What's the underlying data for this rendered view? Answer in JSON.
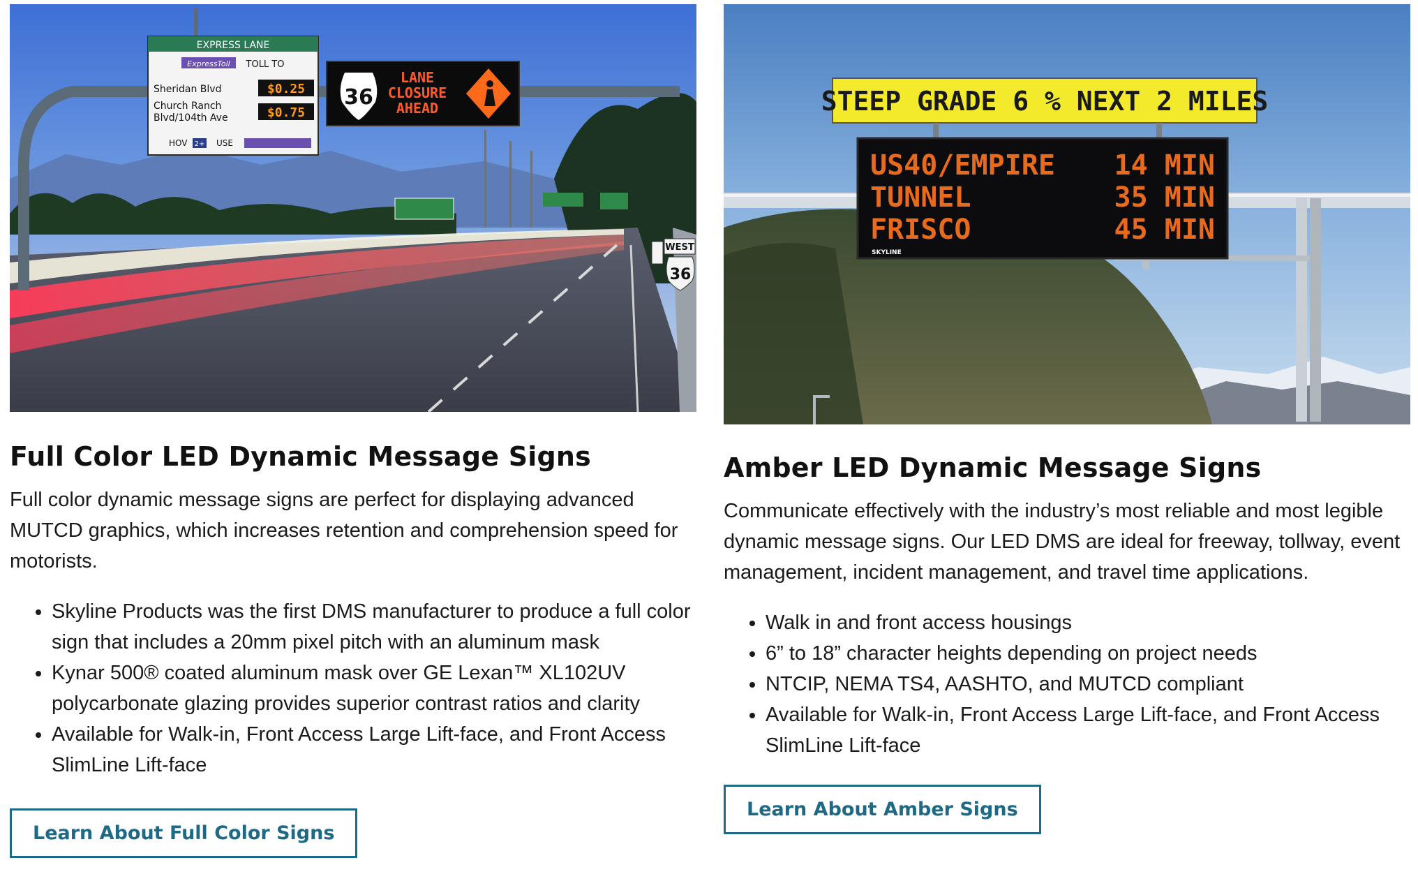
{
  "left": {
    "title": "Full Color LED Dynamic Message Signs",
    "description": "Full color dynamic message signs are perfect for displaying advanced MUTCD graphics, which increases retention and comprehension speed for motorists.",
    "features": [
      "Skyline Products was the first DMS manufacturer to produce a full color sign that includes a 20mm pixel pitch with an aluminum mask",
      "Kynar 500® coated aluminum mask over GE Lexan™ XL102UV polycarbonate glazing provides superior contrast ratios and clarity",
      "Available for Walk-in, Front Access Large Lift-face, and Front Access SlimLine Lift-face"
    ],
    "button_label": "Learn About Full Color Signs",
    "photo": {
      "express_header": "EXPRESS LANE",
      "express_brand": "ExpressToll",
      "toll_to": "TOLL TO",
      "dest1": "Sheridan Blvd",
      "price1": "$0.25",
      "dest2_line1": "Church Ranch",
      "dest2_line2": "Blvd/104th Ave",
      "price2": "$0.75",
      "hov_label": "HOV",
      "hov_num": "2+",
      "use_label": "USE",
      "route_number": "36",
      "closure_line1": "LANE",
      "closure_line2": "CLOSURE",
      "closure_line3": "AHEAD",
      "west_label": "WEST",
      "west_route": "36"
    }
  },
  "right": {
    "title": "Amber LED Dynamic Message Signs",
    "description": "Communicate effectively with the industry’s most reliable and most legible dynamic message signs. Our LED DMS are ideal for freeway, tollway, event management, incident management, and travel time applications.",
    "features": [
      "Walk in and front access housings",
      "6” to 18” character heights depending on project needs",
      "NTCIP, NEMA TS4, AASHTO, and MUTCD compliant",
      "Available for Walk-in, Front Access Large Lift-face, and Front Access SlimLine Lift-face"
    ],
    "button_label": "Learn About Amber Signs",
    "photo": {
      "yellow_sign": "STEEP GRADE 6 % NEXT 2 MILES",
      "row1_dest": "US40/EMPIRE",
      "row1_time": "14 MIN",
      "row2_dest": "TUNNEL",
      "row2_time": "35 MIN",
      "row3_dest": "FRISCO",
      "row3_time": "45 MIN",
      "brand": "SKYLINE"
    }
  },
  "colors": {
    "button_accent": "#1e6a86",
    "amber_led": "#e86a1c",
    "closure_led": "#ff5a2a"
  }
}
